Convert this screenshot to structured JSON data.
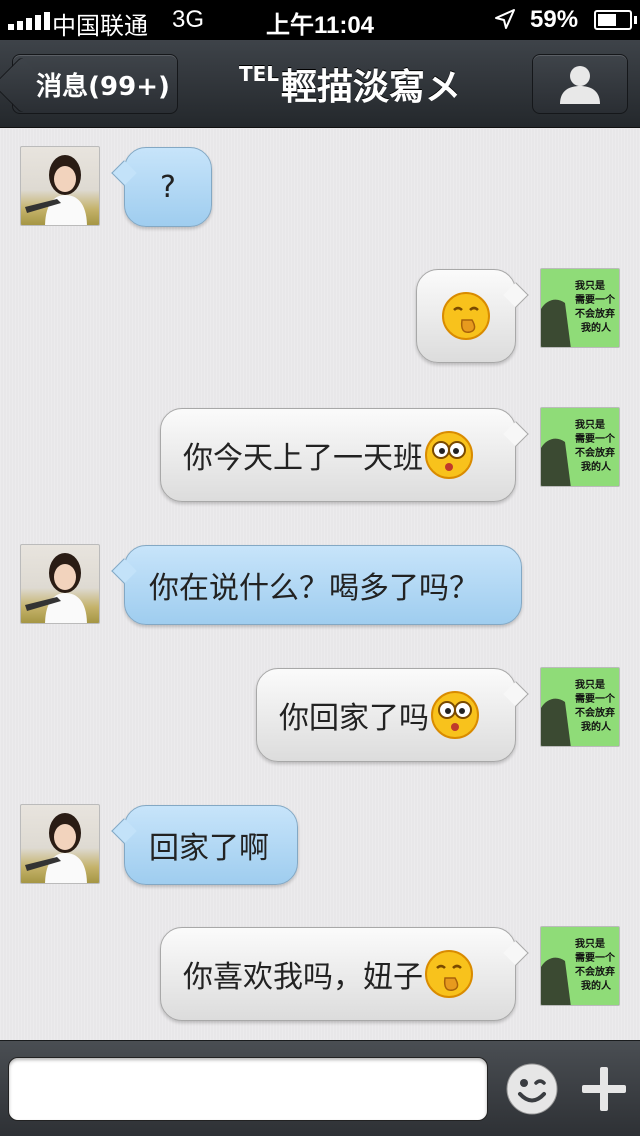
{
  "status_bar": {
    "carrier": "中国联通",
    "network": "3G",
    "time": "上午11:04",
    "battery_percent": "59%",
    "battery_level": 0.59
  },
  "nav": {
    "back_label": "消息(99+)",
    "title_prefix": "TEL",
    "title": "輕描淡寫メ",
    "back_icon": "chevron-left-icon",
    "contact_icon": "person-icon"
  },
  "messages": [
    {
      "from": "other",
      "text": "?",
      "emoji": null
    },
    {
      "from": "me",
      "text": "",
      "emoji": "shy-face"
    },
    {
      "from": "me",
      "text": "你今天上了一天班",
      "emoji": "dizzy-face"
    },
    {
      "from": "other",
      "text": "你在说什么？喝多了吗？",
      "emoji": null
    },
    {
      "from": "me",
      "text": "你回家了吗",
      "emoji": "dizzy-face"
    },
    {
      "from": "other",
      "text": "回家了啊",
      "emoji": null
    },
    {
      "from": "me",
      "text": "你喜欢我吗，妞子",
      "emoji": "shy-face"
    }
  ],
  "avatar_me_caption": [
    "我只是",
    "需要一个",
    "不会放弃",
    "我的人"
  ],
  "input": {
    "placeholder": "",
    "value": ""
  },
  "colors": {
    "incoming_bubble": "#a9d3f2",
    "outgoing_bubble": "#efefef",
    "nav_bar": "#2f3338",
    "background": "#e8e7e9"
  }
}
